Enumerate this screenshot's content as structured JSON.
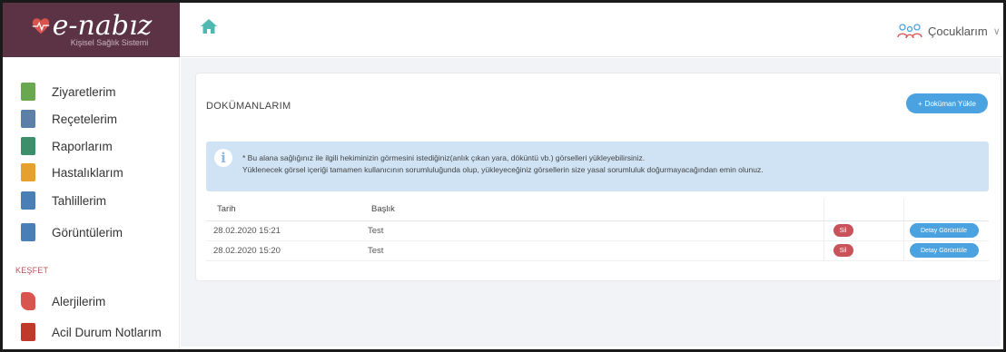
{
  "logo": {
    "text": "e-nabız",
    "subtitle": "Kişisel Sağlık Sistemi"
  },
  "topbar": {
    "children_label": "Çocuklarım",
    "chevron": "∨"
  },
  "sidebar": {
    "items": [
      {
        "label": "Ziyaretlerim",
        "icon": "building-icon",
        "color": "#6aa84f"
      },
      {
        "label": "Reçetelerim",
        "icon": "prescription-icon",
        "color": "#5b7fa6"
      },
      {
        "label": "Raporlarım",
        "icon": "report-icon",
        "color": "#3b8f6a"
      },
      {
        "label": "Hastalıklarım",
        "icon": "patient-icon",
        "color": "#e5a12b"
      },
      {
        "label": "Tahlillerim",
        "icon": "test-tubes-icon",
        "color": "#4a7fb5"
      },
      {
        "label": "Görüntülerim",
        "icon": "image-icon",
        "color": "#4a7fb5"
      }
    ],
    "section_label": "KEŞFET",
    "explore_items": [
      {
        "label": "Alerjilerim",
        "icon": "allergy-icon",
        "color": "#d9534f"
      },
      {
        "label": "Acil Durum Notlarım",
        "icon": "notes-icon",
        "color": "#c0392b"
      }
    ]
  },
  "main": {
    "title": "DOKÜMANLARIM",
    "upload_label": "Doküman Yükle",
    "info_line1": "* Bu alana sağlığınız ile ilgili hekiminizin görmesini istediğiniz(anlık çıkan yara, döküntü vb.) görselleri yükleyebilirsiniz.",
    "info_line2": "Yüklenecek görsel içeriği tamamen kullanıcının sorumluluğunda olup, yükleyeceğiniz görsellerin size yasal sorumluluk doğurmayacağından emin olunuz.",
    "table": {
      "headers": [
        "Tarih",
        "Başlık",
        "",
        ""
      ],
      "rows": [
        {
          "date": "28.02.2020 15:21",
          "title": "Test",
          "delete_label": "Sil",
          "detail_label": "Detay Görüntüle"
        },
        {
          "date": "28.02.2020 15:20",
          "title": "Test",
          "delete_label": "Sil",
          "detail_label": "Detay Görüntüle"
        }
      ]
    }
  }
}
